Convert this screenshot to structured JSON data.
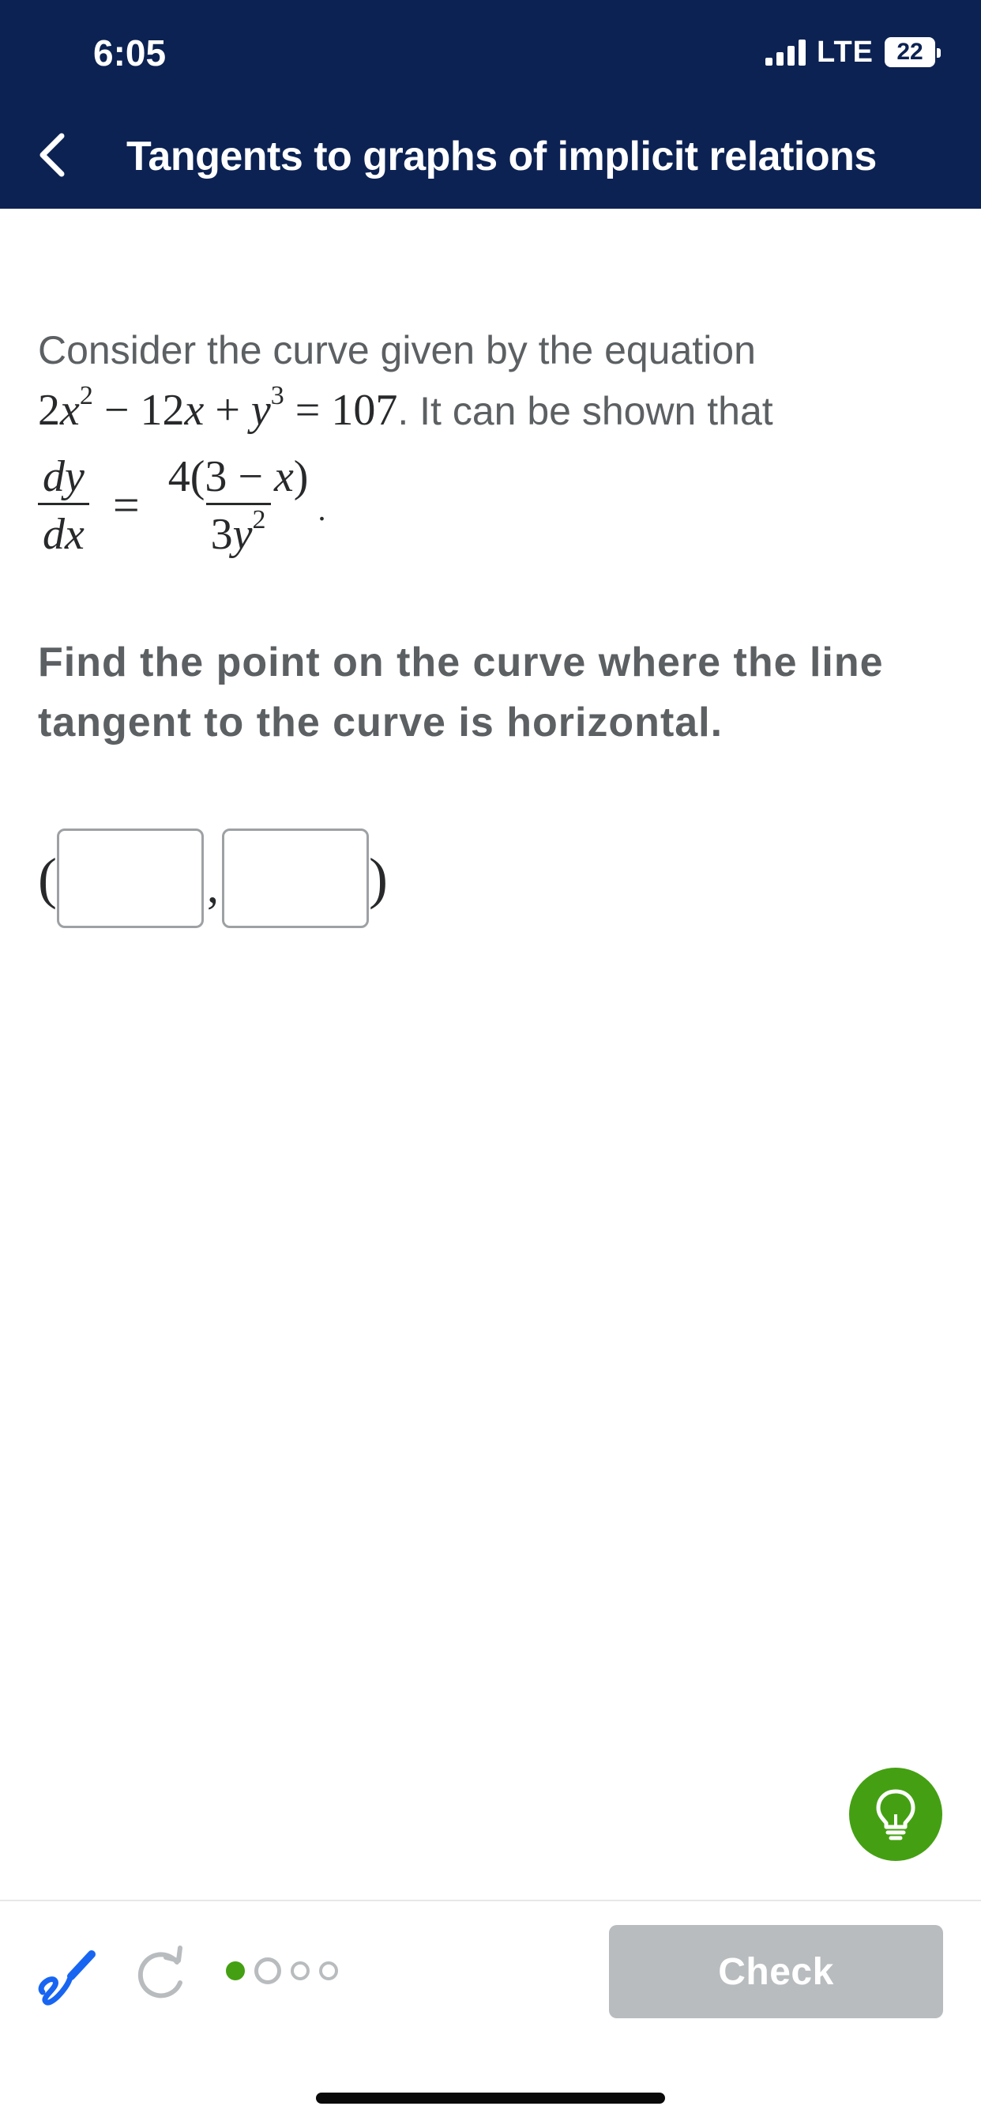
{
  "status_bar": {
    "time": "6:05",
    "network": "LTE",
    "battery": "22"
  },
  "nav": {
    "title": "Tangents to graphs of implicit relations",
    "back_icon": "chevron-left-icon"
  },
  "problem": {
    "intro": "Consider the curve given by the equation",
    "eq_a": "2",
    "eq_x": "x",
    "eq_exp2": "2",
    "eq_minus": " − 12",
    "eq_x2": "x",
    "eq_plus": " + ",
    "eq_y": "y",
    "eq_exp3": "3",
    "eq_rhs": " = 107",
    "after_eq": ". It can be shown that",
    "dy": "dy",
    "dx": "dx",
    "equals": "=",
    "num": "4(3 − ",
    "num_x": "x",
    "num_close": ")",
    "den_coef": "3",
    "den_y": "y",
    "den_exp": "2",
    "period": "."
  },
  "prompt": "Find the point on the curve where the line tangent to the curve is horizontal.",
  "answer": {
    "open_paren": "(",
    "comma": ",",
    "close_paren": ")",
    "x_value": "",
    "y_value": ""
  },
  "toolbar": {
    "check_label": "Check",
    "draw_icon": "pencil-scribble-icon",
    "redo_icon": "redo-icon",
    "hint_icon": "lightbulb-icon",
    "progress_total": 4,
    "progress_current": 2
  },
  "colors": {
    "header": "#0c2253",
    "accent_green": "#44a012",
    "check_disabled": "#b8bcbf",
    "draw_blue": "#1865f2"
  }
}
